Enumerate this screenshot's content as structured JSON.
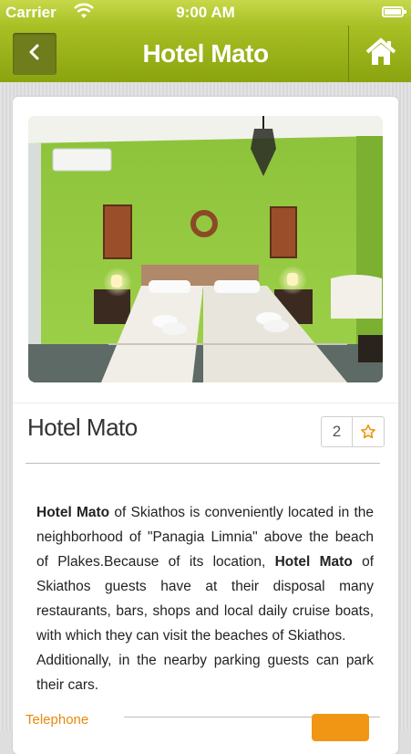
{
  "status_bar": {
    "carrier": "Carrier",
    "time": "9:00 AM"
  },
  "nav": {
    "title": "Hotel Mato",
    "back_icon": "chevron-left-icon",
    "home_icon": "home-icon"
  },
  "hotel": {
    "name": "Hotel Mato",
    "favorites_count": "2",
    "description_parts": [
      {
        "bold": "Hotel Mato"
      },
      {
        "text": " of Skiathos is conveniently located in the neighborhood of \"Panagia Limnia\" above the beach of Plakes.Because of its location, "
      },
      {
        "bold": "Hotel Mato"
      },
      {
        "text": " of Skiathos guests have at their disposal many restaurants, bars, shops and local daily cruise boats, with which they can visit the beaches of Skiathos."
      }
    ],
    "description_2": "Additionally, in the nearby parking guests can park their cars."
  },
  "contact": {
    "telephone_label": "Telephone"
  },
  "colors": {
    "brand_green": "#a9c025",
    "accent_orange": "#f19614"
  }
}
